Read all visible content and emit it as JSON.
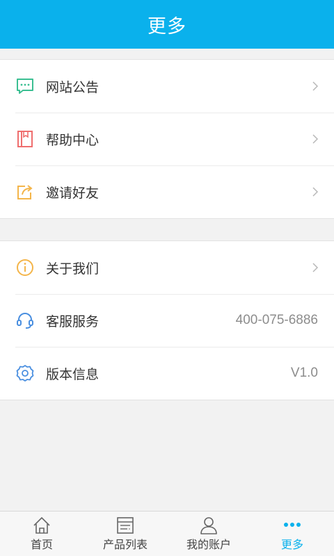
{
  "header": {
    "title": "更多"
  },
  "group1": [
    {
      "label": "网站公告",
      "icon": "chat-bubble-icon"
    },
    {
      "label": "帮助中心",
      "icon": "book-icon"
    },
    {
      "label": "邀请好友",
      "icon": "share-icon"
    }
  ],
  "group2": [
    {
      "label": "关于我们",
      "icon": "info-icon"
    },
    {
      "label": "客服服务",
      "icon": "headset-icon",
      "value": "400-075-6886"
    },
    {
      "label": "版本信息",
      "icon": "gear-icon",
      "value": "V1.0"
    }
  ],
  "tabbar": {
    "tabs": [
      {
        "label": "首页",
        "icon": "home-icon"
      },
      {
        "label": "产品列表",
        "icon": "list-icon"
      },
      {
        "label": "我的账户",
        "icon": "user-icon"
      },
      {
        "label": "更多",
        "icon": "more-dots-icon",
        "active": true
      }
    ]
  },
  "colors": {
    "accent": "#0ab1ec",
    "background": "#f2f2f2"
  }
}
